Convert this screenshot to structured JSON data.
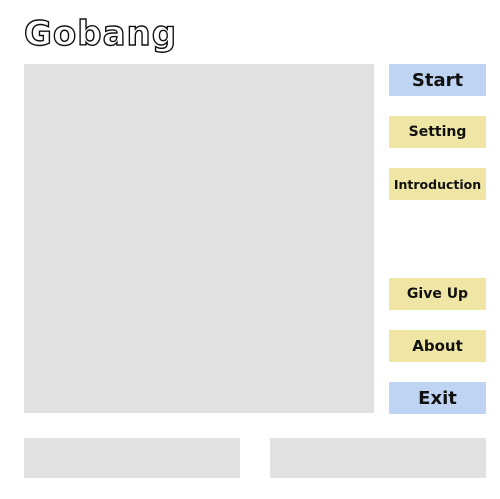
{
  "app": {
    "title": "Gobang"
  },
  "buttons": {
    "start": "Start",
    "setting": "Setting",
    "introduction": "Introduction",
    "give_up": "Give Up",
    "about": "About",
    "exit": "Exit"
  },
  "colors": {
    "primary_button": "#bfd4f2",
    "secondary_button": "#efe6a6",
    "panel": "#e1e1e1",
    "text": "#111111"
  }
}
